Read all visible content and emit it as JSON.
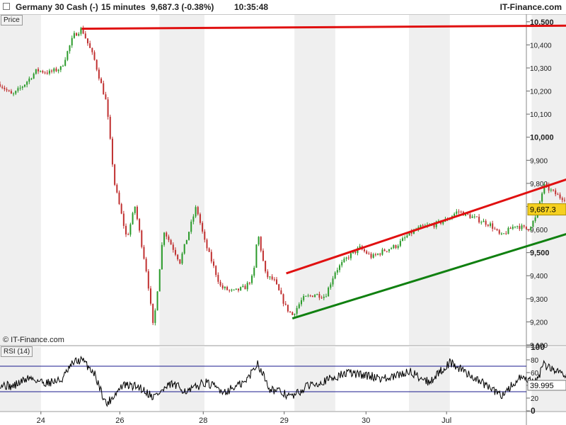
{
  "header": {
    "instrument": "Germany 30 Cash (-)",
    "timeframe": "15 minutes",
    "quote": "9,687.3 (-0.38%)",
    "time": "10:35:48",
    "brand": "IT-Finance.com"
  },
  "panels": {
    "price_label": "Price",
    "rsi_label": "RSI (14)",
    "copyright": "© IT-Finance.com"
  },
  "colors": {
    "bull_candle": "#2a9a2a",
    "bear_candle": "#c03030",
    "resistance_line": "#e01010",
    "support_line": "#108010",
    "rsi_line": "#000000",
    "rsi_band": "#1a1a8c",
    "last_price_tag": "#f5d020",
    "band_shade": "#efefef"
  },
  "chart_data": [
    {
      "type": "candlestick",
      "x": {
        "ticks": [
          "24",
          "26",
          "28",
          "29",
          "30",
          "Jul"
        ]
      },
      "y": {
        "range": [
          9100,
          10530
        ],
        "ticks": [
          9100,
          9200,
          9300,
          9400,
          9500,
          9600,
          9700,
          9800,
          9900,
          10000,
          10100,
          10200,
          10300,
          10400,
          10500
        ],
        "tick_labels": [
          "9,100",
          "9,200",
          "9,300",
          "9,400",
          "9,500",
          "9,600",
          "9,700",
          "9,800",
          "9,900",
          "10,000",
          "10,100",
          "10,200",
          "10,300",
          "10,400",
          "10,500"
        ],
        "major": [
          9500,
          10000,
          10500
        ]
      },
      "last_price": 9687.3,
      "last_price_label": "9,687.3",
      "shape": [
        [
          1.0,
          10230
        ],
        [
          1.3,
          10180
        ],
        [
          1.6,
          10230
        ],
        [
          1.9,
          10290
        ],
        [
          2.2,
          10280
        ],
        [
          2.5,
          10300
        ],
        [
          2.8,
          10440
        ],
        [
          3.0,
          10470
        ],
        [
          3.3,
          10340
        ],
        [
          3.6,
          10150
        ],
        [
          3.8,
          9800
        ],
        [
          4.1,
          9560
        ],
        [
          4.3,
          9700
        ],
        [
          4.6,
          9400
        ],
        [
          4.75,
          9170
        ],
        [
          5.0,
          9600
        ],
        [
          5.4,
          9460
        ],
        [
          5.8,
          9700
        ],
        [
          6.0,
          9550
        ],
        [
          6.4,
          9350
        ],
        [
          6.7,
          9330
        ],
        [
          7.0,
          9350
        ],
        [
          7.2,
          9400
        ],
        [
          7.3,
          9590
        ],
        [
          7.5,
          9400
        ],
        [
          7.7,
          9380
        ],
        [
          8.0,
          9260
        ],
        [
          8.15,
          9230
        ],
        [
          8.4,
          9300
        ],
        [
          8.7,
          9320
        ],
        [
          8.95,
          9310
        ],
        [
          9.2,
          9420
        ],
        [
          9.5,
          9480
        ],
        [
          9.8,
          9520
        ],
        [
          10.1,
          9480
        ],
        [
          10.4,
          9510
        ],
        [
          10.7,
          9530
        ],
        [
          11.0,
          9580
        ],
        [
          11.3,
          9610
        ],
        [
          11.6,
          9620
        ],
        [
          11.9,
          9640
        ],
        [
          12.2,
          9680
        ],
        [
          12.6,
          9650
        ],
        [
          13.0,
          9620
        ],
        [
          13.25,
          9570
        ],
        [
          13.6,
          9620
        ],
        [
          13.9,
          9600
        ],
        [
          14.1,
          9650
        ],
        [
          14.3,
          9790
        ],
        [
          14.7,
          9740
        ],
        [
          15.0,
          9730
        ],
        [
          15.4,
          9740
        ],
        [
          15.7,
          9740
        ],
        [
          16.0,
          9720
        ],
        [
          16.15,
          9660
        ],
        [
          16.3,
          9687
        ]
      ],
      "trendlines": [
        {
          "role": "resistance",
          "from": [
            3.0,
            10470
          ],
          "to": [
            16.5,
            10485
          ]
        },
        {
          "role": "resistance",
          "from": [
            8.0,
            9410
          ],
          "to": [
            16.5,
            9915
          ]
        },
        {
          "role": "support",
          "from": [
            8.15,
            9215
          ],
          "to": [
            16.95,
            9695
          ]
        }
      ]
    },
    {
      "type": "line",
      "y": {
        "range": [
          0,
          100
        ],
        "ticks": [
          0,
          20,
          40,
          60,
          80,
          100
        ],
        "bands": [
          30,
          70
        ]
      },
      "last_value": 39.995,
      "last_value_label": "39.995",
      "shape": [
        [
          1.0,
          42
        ],
        [
          1.3,
          38
        ],
        [
          1.7,
          52
        ],
        [
          2.1,
          44
        ],
        [
          2.5,
          48
        ],
        [
          2.8,
          76
        ],
        [
          3.0,
          80
        ],
        [
          3.3,
          60
        ],
        [
          3.6,
          10
        ],
        [
          4.0,
          40
        ],
        [
          4.4,
          38
        ],
        [
          4.75,
          22
        ],
        [
          5.2,
          42
        ],
        [
          5.6,
          30
        ],
        [
          6.0,
          45
        ],
        [
          6.5,
          30
        ],
        [
          7.0,
          45
        ],
        [
          7.3,
          75
        ],
        [
          7.6,
          35
        ],
        [
          8.15,
          22
        ],
        [
          8.6,
          42
        ],
        [
          9.0,
          48
        ],
        [
          9.5,
          60
        ],
        [
          10.0,
          55
        ],
        [
          10.5,
          50
        ],
        [
          11.0,
          62
        ],
        [
          11.5,
          45
        ],
        [
          12.0,
          76
        ],
        [
          12.6,
          52
        ],
        [
          13.25,
          24
        ],
        [
          13.7,
          50
        ],
        [
          14.1,
          45
        ],
        [
          14.3,
          72
        ],
        [
          14.7,
          60
        ],
        [
          15.2,
          55
        ],
        [
          15.7,
          57
        ],
        [
          16.0,
          50
        ],
        [
          16.15,
          25
        ],
        [
          16.3,
          40
        ]
      ]
    }
  ]
}
